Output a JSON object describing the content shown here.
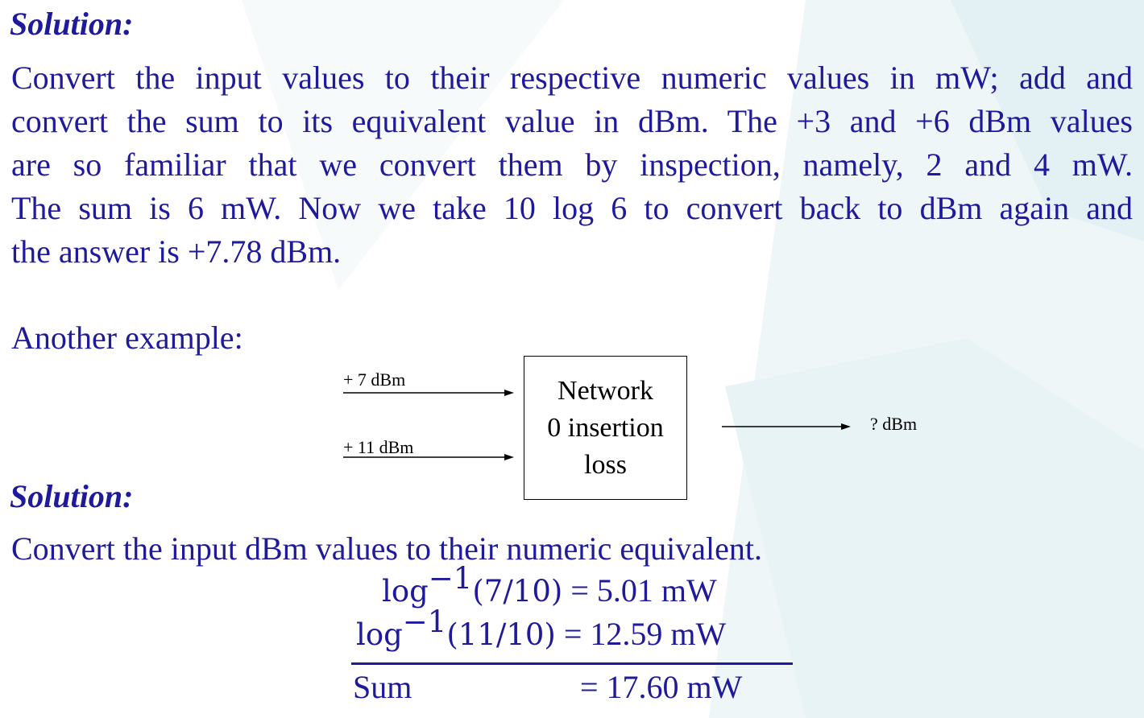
{
  "solution1": {
    "heading": "Solution:",
    "lines": [
      "Convert the input values to their respective numeric values in mW; add and",
      "convert the sum to its equivalent value in dBm. The +3 and +6 dBm values",
      "are so familiar that we convert them by inspection, namely, 2 and 4 mW.",
      "The sum is 6 mW. Now we take 10 log 6 to convert back to dBm again and",
      "the answer is +7.78 dBm."
    ]
  },
  "example": {
    "label": "Another example:"
  },
  "diagram": {
    "input1": "+ 7 dBm",
    "input2": "+ 11 dBm",
    "box_lines": [
      "Network",
      "0 insertion",
      "loss"
    ],
    "output": "? dBm"
  },
  "solution2": {
    "heading": "Solution:",
    "intro": "Convert the input dBm values to their numeric equivalent."
  },
  "equations": {
    "eq1": {
      "lhs_base": "log",
      "lhs_sup": "−1",
      "lhs_arg": "(7/10)",
      "rhs": "= 5.01 mW"
    },
    "eq2": {
      "lhs_base": "log",
      "lhs_sup": "−1",
      "lhs_arg": "(11/10)",
      "rhs": "= 12.59 mW"
    },
    "sum": {
      "label": "Sum",
      "rhs": "= 17.60 mW"
    }
  }
}
